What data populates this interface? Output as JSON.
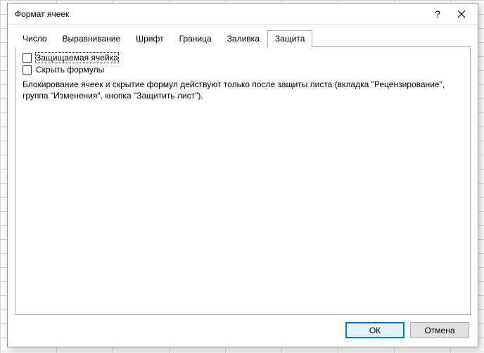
{
  "window": {
    "title": "Формат ячеек"
  },
  "tabs": {
    "number": "Число",
    "alignment": "Выравнивание",
    "font": "Шрифт",
    "border": "Граница",
    "fill": "Заливка",
    "protection": "Защита"
  },
  "protection": {
    "locked_label": "Защищаемая ячейка",
    "hidden_label": "Скрыть формулы",
    "info": "Блокирование ячеек и скрытие формул действуют только после защиты листа (вкладка \"Рецензирование\", группа \"Изменения\", кнопка \"Защитить лист\")."
  },
  "buttons": {
    "ok": "ОК",
    "cancel": "Отмена"
  }
}
